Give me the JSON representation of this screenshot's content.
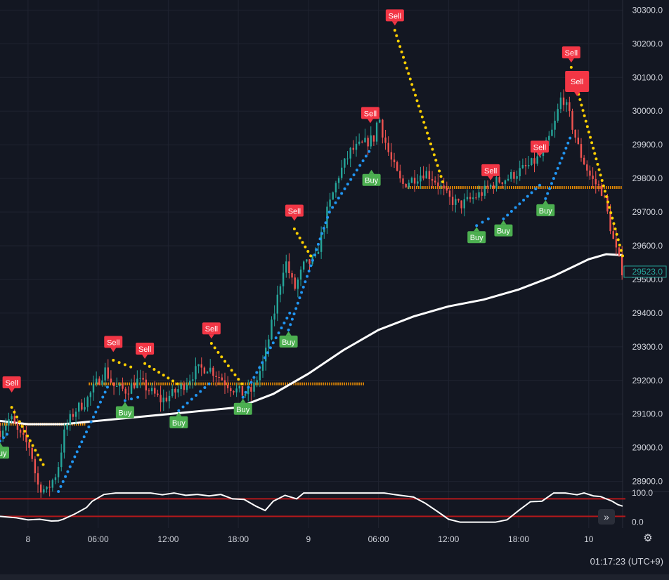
{
  "clock": {
    "time": "01:17:23",
    "timezone": "(UTC+9)"
  },
  "controls": {
    "scroll_glyph": "»",
    "scroll_icon": "double-chevron-right-icon",
    "settings_icon": "gear-icon",
    "settings_glyph": "⚙"
  },
  "chart_data": {
    "type": "candlestick",
    "price_axis": {
      "ticks": [
        "30300.0",
        "30200.0",
        "30100.0",
        "30000.0",
        "29900.0",
        "29800.0",
        "29700.0",
        "29600.0",
        "29500.0",
        "29400.0",
        "29300.0",
        "29200.0",
        "29100.0",
        "29000.0",
        "28900.0"
      ],
      "tick_values": [
        30300,
        30200,
        30100,
        30000,
        29900,
        29800,
        29700,
        29600,
        29500,
        29400,
        29300,
        29200,
        29100,
        29000,
        28900
      ],
      "range": [
        28870,
        30330
      ],
      "last_price_label": "29523.0",
      "last_price": 29523
    },
    "time_axis": {
      "ticks": [
        {
          "label": "8",
          "t": 0
        },
        {
          "label": "06:00",
          "t": 6
        },
        {
          "label": "12:00",
          "t": 12
        },
        {
          "label": "18:00",
          "t": 18
        },
        {
          "label": "9",
          "t": 24
        },
        {
          "label": "06:00",
          "t": 30
        },
        {
          "label": "12:00",
          "t": 36
        },
        {
          "label": "18:00",
          "t": 42
        },
        {
          "label": "10",
          "t": 48
        }
      ],
      "range_hours": [
        -2.4,
        50.9
      ]
    },
    "price_path": [
      [
        -2.4,
        29050
      ],
      [
        -1.5,
        29090
      ],
      [
        -0.8,
        29040
      ],
      [
        0.2,
        29000
      ],
      [
        0.8,
        28890
      ],
      [
        1.6,
        28870
      ],
      [
        2.5,
        28930
      ],
      [
        3.2,
        29060
      ],
      [
        4.0,
        29110
      ],
      [
        5.0,
        29140
      ],
      [
        6.0,
        29200
      ],
      [
        6.6,
        29230
      ],
      [
        7.4,
        29180
      ],
      [
        8.4,
        29170
      ],
      [
        9.4,
        29200
      ],
      [
        10.4,
        29170
      ],
      [
        11.4,
        29140
      ],
      [
        12.4,
        29160
      ],
      [
        13.4,
        29190
      ],
      [
        14.4,
        29230
      ],
      [
        15.4,
        29240
      ],
      [
        16.4,
        29210
      ],
      [
        17.4,
        29180
      ],
      [
        18.4,
        29160
      ],
      [
        19.2,
        29170
      ],
      [
        20.2,
        29260
      ],
      [
        21.2,
        29420
      ],
      [
        22.0,
        29560
      ],
      [
        22.8,
        29470
      ],
      [
        23.6,
        29540
      ],
      [
        24.6,
        29560
      ],
      [
        25.6,
        29700
      ],
      [
        26.6,
        29810
      ],
      [
        27.6,
        29880
      ],
      [
        28.6,
        29900
      ],
      [
        29.6,
        29920
      ],
      [
        30.0,
        29990
      ],
      [
        30.4,
        29930
      ],
      [
        31.0,
        29860
      ],
      [
        32.0,
        29780
      ],
      [
        33.0,
        29800
      ],
      [
        34.0,
        29820
      ],
      [
        35.0,
        29790
      ],
      [
        36.0,
        29740
      ],
      [
        37.0,
        29720
      ],
      [
        38.0,
        29740
      ],
      [
        39.0,
        29760
      ],
      [
        40.0,
        29790
      ],
      [
        41.0,
        29800
      ],
      [
        42.0,
        29820
      ],
      [
        43.0,
        29840
      ],
      [
        44.0,
        29870
      ],
      [
        45.0,
        29950
      ],
      [
        45.7,
        30050
      ],
      [
        46.4,
        29980
      ],
      [
        47.2,
        29880
      ],
      [
        48.2,
        29800
      ],
      [
        49.2,
        29760
      ],
      [
        50.2,
        29600
      ],
      [
        50.9,
        29523
      ]
    ],
    "sma_line": [
      [
        -2.4,
        29080
      ],
      [
        0,
        29070
      ],
      [
        3,
        29070
      ],
      [
        6,
        29080
      ],
      [
        9,
        29090
      ],
      [
        12,
        29100
      ],
      [
        15,
        29110
      ],
      [
        18,
        29120
      ],
      [
        21,
        29160
      ],
      [
        24,
        29220
      ],
      [
        27,
        29290
      ],
      [
        30,
        29350
      ],
      [
        33,
        29390
      ],
      [
        36,
        29420
      ],
      [
        39,
        29440
      ],
      [
        42,
        29470
      ],
      [
        45,
        29510
      ],
      [
        48,
        29560
      ],
      [
        49.5,
        29575
      ],
      [
        50.9,
        29572
      ]
    ],
    "support_lines": [
      {
        "t0": -2.4,
        "t1": 4.9,
        "price": 29070
      },
      {
        "t0": 5.2,
        "t1": 28.8,
        "price": 29190
      },
      {
        "t0": 32.5,
        "t1": 50.9,
        "price": 29773
      }
    ],
    "buy_signals": [
      {
        "label": "Buy",
        "t": -2.4,
        "price": 29020
      },
      {
        "label": "Buy",
        "t": 8.3,
        "price": 29140
      },
      {
        "label": "Buy",
        "t": 12.9,
        "price": 29110
      },
      {
        "label": "Buy",
        "t": 18.4,
        "price": 29150
      },
      {
        "label": "Buy",
        "t": 22.3,
        "price": 29350
      },
      {
        "label": "Buy",
        "t": 29.4,
        "price": 29830
      },
      {
        "label": "Buy",
        "t": 38.4,
        "price": 29660
      },
      {
        "label": "Buy",
        "t": 40.7,
        "price": 29680
      },
      {
        "label": "Buy",
        "t": 44.3,
        "price": 29740
      }
    ],
    "sell_signals": [
      {
        "label": "Sell",
        "t": -1.4,
        "price": 29160
      },
      {
        "label": "Sell",
        "t": 7.3,
        "price": 29280
      },
      {
        "label": "Sell",
        "t": 10.0,
        "price": 29260
      },
      {
        "label": "Sell",
        "t": 15.7,
        "price": 29320
      },
      {
        "label": "Sell",
        "t": 22.8,
        "price": 29670
      },
      {
        "label": "Sell",
        "t": 29.3,
        "price": 29960
      },
      {
        "label": "Sell",
        "t": 31.4,
        "price": 30250
      },
      {
        "label": "Sell",
        "t": 39.6,
        "price": 29790
      },
      {
        "label": "Sell",
        "t": 43.8,
        "price": 29860
      },
      {
        "label": "Sell",
        "t": 46.5,
        "price": 30140
      }
    ],
    "featured_sell": {
      "label": "Sell",
      "t": 47.0,
      "price": 30040
    },
    "trail_up_segments": [
      {
        "t0": -2.4,
        "p0": 29020,
        "t1": -1.8,
        "p1": 29040
      },
      {
        "t0": 2.6,
        "p0": 28870,
        "t1": 6.8,
        "p1": 29180
      },
      {
        "t0": 8.3,
        "p0": 29140,
        "t1": 9.4,
        "p1": 29150
      },
      {
        "t0": 12.9,
        "p0": 29110,
        "t1": 15.5,
        "p1": 29190
      },
      {
        "t0": 18.4,
        "p0": 29150,
        "t1": 22.4,
        "p1": 29400
      },
      {
        "t0": 22.3,
        "p0": 29350,
        "t1": 25.8,
        "p1": 29700
      },
      {
        "t0": 25.8,
        "p0": 29700,
        "t1": 29.2,
        "p1": 29880
      },
      {
        "t0": 38.4,
        "p0": 29660,
        "t1": 39.4,
        "p1": 29680
      },
      {
        "t0": 40.7,
        "p0": 29680,
        "t1": 43.8,
        "p1": 29780
      },
      {
        "t0": 44.3,
        "p0": 29740,
        "t1": 46.4,
        "p1": 29920
      }
    ],
    "trail_down_segments": [
      {
        "t0": -1.4,
        "p0": 29120,
        "t1": 1.3,
        "p1": 28950
      },
      {
        "t0": 7.3,
        "p0": 29260,
        "t1": 8.8,
        "p1": 29240
      },
      {
        "t0": 10.0,
        "p0": 29250,
        "t1": 12.8,
        "p1": 29190
      },
      {
        "t0": 15.7,
        "p0": 29310,
        "t1": 18.3,
        "p1": 29190
      },
      {
        "t0": 22.8,
        "p0": 29650,
        "t1": 24.2,
        "p1": 29570
      },
      {
        "t0": 31.4,
        "p0": 30240,
        "t1": 35.5,
        "p1": 29790
      },
      {
        "t0": 46.5,
        "p0": 30130,
        "t1": 50.9,
        "p1": 29570
      }
    ],
    "oscillator": {
      "y_ticks": [
        "100.0",
        "0.0"
      ],
      "tick_values": [
        100,
        0
      ],
      "range": [
        -20,
        105
      ],
      "upper_band": 80,
      "lower_band": 20,
      "points": [
        [
          -2.4,
          20
        ],
        [
          -1,
          15
        ],
        [
          0,
          8
        ],
        [
          1,
          10
        ],
        [
          2,
          4
        ],
        [
          2.6,
          5
        ],
        [
          3,
          10
        ],
        [
          4,
          28
        ],
        [
          5,
          50
        ],
        [
          5.5,
          72
        ],
        [
          6.5,
          95
        ],
        [
          7.5,
          100
        ],
        [
          9,
          100
        ],
        [
          10.5,
          100
        ],
        [
          11.5,
          94
        ],
        [
          12.5,
          100
        ],
        [
          13.5,
          92
        ],
        [
          14.5,
          95
        ],
        [
          15.5,
          90
        ],
        [
          16.5,
          95
        ],
        [
          17.5,
          80
        ],
        [
          18.5,
          78
        ],
        [
          19.5,
          55
        ],
        [
          20.3,
          40
        ],
        [
          21,
          72
        ],
        [
          22,
          92
        ],
        [
          23,
          80
        ],
        [
          23.6,
          100
        ],
        [
          25,
          100
        ],
        [
          27,
          100
        ],
        [
          29,
          100
        ],
        [
          30.5,
          100
        ],
        [
          31.5,
          94
        ],
        [
          33,
          86
        ],
        [
          34,
          65
        ],
        [
          35,
          38
        ],
        [
          36,
          10
        ],
        [
          37,
          0
        ],
        [
          38,
          0
        ],
        [
          39,
          0
        ],
        [
          40,
          0
        ],
        [
          41,
          8
        ],
        [
          42,
          40
        ],
        [
          43,
          70
        ],
        [
          44,
          72
        ],
        [
          45,
          100
        ],
        [
          46,
          100
        ],
        [
          47,
          94
        ],
        [
          47.6,
          100
        ],
        [
          48.4,
          90
        ],
        [
          49,
          88
        ],
        [
          50,
          72
        ],
        [
          50.5,
          60
        ],
        [
          50.9,
          55
        ]
      ]
    }
  }
}
